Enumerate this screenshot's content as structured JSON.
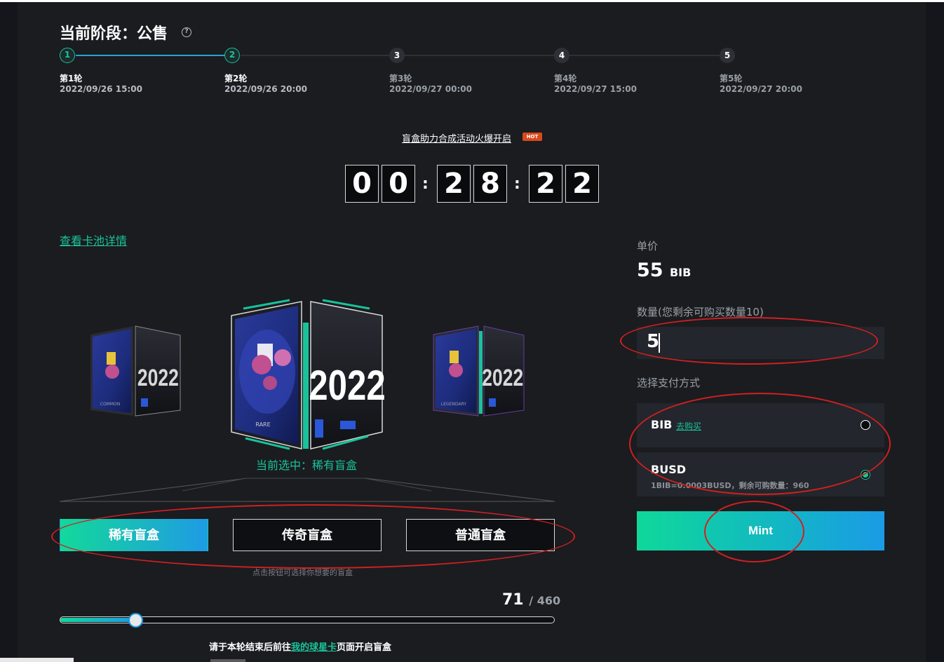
{
  "stage": {
    "title": "当前阶段：公售",
    "help_icon": "?"
  },
  "rounds": [
    {
      "num": "1",
      "label": "第1轮",
      "date": "2022/09/26 15:00",
      "status": "done"
    },
    {
      "num": "2",
      "label": "第2轮",
      "date": "2022/09/26 20:00",
      "status": "current"
    },
    {
      "num": "3",
      "label": "第3轮",
      "date": "2022/09/27 00:00",
      "status": "upcoming"
    },
    {
      "num": "4",
      "label": "第4轮",
      "date": "2022/09/27 15:00",
      "status": "upcoming"
    },
    {
      "num": "5",
      "label": "第5轮",
      "date": "2022/09/27 20:00",
      "status": "upcoming"
    }
  ],
  "promo": {
    "text": "盲盒助力合成活动火爆开启",
    "badge": "HOT"
  },
  "countdown": {
    "digits": [
      "0",
      "0",
      "2",
      "8",
      "2",
      "2"
    ],
    "separator": ":"
  },
  "pool_link": "查看卡池详情",
  "carousel": {
    "cards": [
      "2022",
      "2022",
      "2022"
    ],
    "side_caption_left": "COMMON",
    "center_caption": "RARE",
    "side_caption_right": "LEGENDARY"
  },
  "selected_label": "当前选中：稀有盲盒",
  "box_buttons": [
    {
      "label": "稀有盲盒",
      "active": true
    },
    {
      "label": "传奇盲盒",
      "active": false
    },
    {
      "label": "普通盲盒",
      "active": false
    }
  ],
  "hint": "点击按钮可选择你想要的盲盒",
  "progress": {
    "sold": "71",
    "total": "/ 460",
    "fraction": 0.154
  },
  "bottom_note": {
    "prefix": "请于本轮结束后前往",
    "link": "我的球星卡",
    "suffix": "页面开启盲盒"
  },
  "purchase": {
    "unit_price_label": "单价",
    "price": "55",
    "currency": "BIB",
    "qty_label": "数量(您剩余可购买数量10)",
    "qty_value": "5",
    "payment_label": "选择支付方式",
    "methods": [
      {
        "name": "BIB",
        "link": "去购买",
        "note": "",
        "selected": false
      },
      {
        "name": "BUSD",
        "link": "",
        "note": "1BIB=0.0003BUSD，剩余可购数量：960",
        "selected": true
      }
    ],
    "mint_label": "Mint"
  },
  "colors": {
    "accent": "#19c39a",
    "accent_blue": "#1b9be6",
    "annotation": "#d02020",
    "panel": "#1a1c20"
  }
}
